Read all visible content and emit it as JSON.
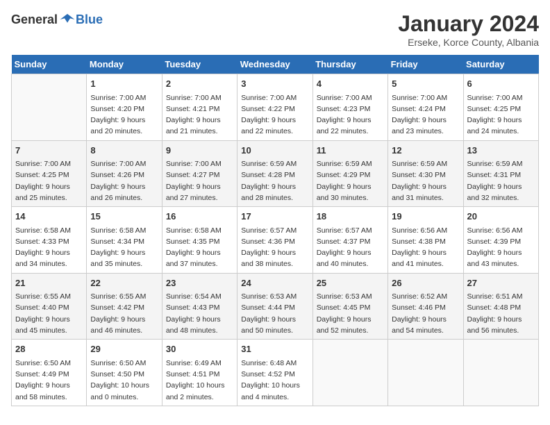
{
  "header": {
    "logo_general": "General",
    "logo_blue": "Blue",
    "month_title": "January 2024",
    "subtitle": "Erseke, Korce County, Albania"
  },
  "days_of_week": [
    "Sunday",
    "Monday",
    "Tuesday",
    "Wednesday",
    "Thursday",
    "Friday",
    "Saturday"
  ],
  "weeks": [
    [
      {
        "day": "",
        "info": ""
      },
      {
        "day": "1",
        "info": "Sunrise: 7:00 AM\nSunset: 4:20 PM\nDaylight: 9 hours\nand 20 minutes."
      },
      {
        "day": "2",
        "info": "Sunrise: 7:00 AM\nSunset: 4:21 PM\nDaylight: 9 hours\nand 21 minutes."
      },
      {
        "day": "3",
        "info": "Sunrise: 7:00 AM\nSunset: 4:22 PM\nDaylight: 9 hours\nand 22 minutes."
      },
      {
        "day": "4",
        "info": "Sunrise: 7:00 AM\nSunset: 4:23 PM\nDaylight: 9 hours\nand 22 minutes."
      },
      {
        "day": "5",
        "info": "Sunrise: 7:00 AM\nSunset: 4:24 PM\nDaylight: 9 hours\nand 23 minutes."
      },
      {
        "day": "6",
        "info": "Sunrise: 7:00 AM\nSunset: 4:25 PM\nDaylight: 9 hours\nand 24 minutes."
      }
    ],
    [
      {
        "day": "7",
        "info": "Sunrise: 7:00 AM\nSunset: 4:25 PM\nDaylight: 9 hours\nand 25 minutes."
      },
      {
        "day": "8",
        "info": "Sunrise: 7:00 AM\nSunset: 4:26 PM\nDaylight: 9 hours\nand 26 minutes."
      },
      {
        "day": "9",
        "info": "Sunrise: 7:00 AM\nSunset: 4:27 PM\nDaylight: 9 hours\nand 27 minutes."
      },
      {
        "day": "10",
        "info": "Sunrise: 6:59 AM\nSunset: 4:28 PM\nDaylight: 9 hours\nand 28 minutes."
      },
      {
        "day": "11",
        "info": "Sunrise: 6:59 AM\nSunset: 4:29 PM\nDaylight: 9 hours\nand 30 minutes."
      },
      {
        "day": "12",
        "info": "Sunrise: 6:59 AM\nSunset: 4:30 PM\nDaylight: 9 hours\nand 31 minutes."
      },
      {
        "day": "13",
        "info": "Sunrise: 6:59 AM\nSunset: 4:31 PM\nDaylight: 9 hours\nand 32 minutes."
      }
    ],
    [
      {
        "day": "14",
        "info": "Sunrise: 6:58 AM\nSunset: 4:33 PM\nDaylight: 9 hours\nand 34 minutes."
      },
      {
        "day": "15",
        "info": "Sunrise: 6:58 AM\nSunset: 4:34 PM\nDaylight: 9 hours\nand 35 minutes."
      },
      {
        "day": "16",
        "info": "Sunrise: 6:58 AM\nSunset: 4:35 PM\nDaylight: 9 hours\nand 37 minutes."
      },
      {
        "day": "17",
        "info": "Sunrise: 6:57 AM\nSunset: 4:36 PM\nDaylight: 9 hours\nand 38 minutes."
      },
      {
        "day": "18",
        "info": "Sunrise: 6:57 AM\nSunset: 4:37 PM\nDaylight: 9 hours\nand 40 minutes."
      },
      {
        "day": "19",
        "info": "Sunrise: 6:56 AM\nSunset: 4:38 PM\nDaylight: 9 hours\nand 41 minutes."
      },
      {
        "day": "20",
        "info": "Sunrise: 6:56 AM\nSunset: 4:39 PM\nDaylight: 9 hours\nand 43 minutes."
      }
    ],
    [
      {
        "day": "21",
        "info": "Sunrise: 6:55 AM\nSunset: 4:40 PM\nDaylight: 9 hours\nand 45 minutes."
      },
      {
        "day": "22",
        "info": "Sunrise: 6:55 AM\nSunset: 4:42 PM\nDaylight: 9 hours\nand 46 minutes."
      },
      {
        "day": "23",
        "info": "Sunrise: 6:54 AM\nSunset: 4:43 PM\nDaylight: 9 hours\nand 48 minutes."
      },
      {
        "day": "24",
        "info": "Sunrise: 6:53 AM\nSunset: 4:44 PM\nDaylight: 9 hours\nand 50 minutes."
      },
      {
        "day": "25",
        "info": "Sunrise: 6:53 AM\nSunset: 4:45 PM\nDaylight: 9 hours\nand 52 minutes."
      },
      {
        "day": "26",
        "info": "Sunrise: 6:52 AM\nSunset: 4:46 PM\nDaylight: 9 hours\nand 54 minutes."
      },
      {
        "day": "27",
        "info": "Sunrise: 6:51 AM\nSunset: 4:48 PM\nDaylight: 9 hours\nand 56 minutes."
      }
    ],
    [
      {
        "day": "28",
        "info": "Sunrise: 6:50 AM\nSunset: 4:49 PM\nDaylight: 9 hours\nand 58 minutes."
      },
      {
        "day": "29",
        "info": "Sunrise: 6:50 AM\nSunset: 4:50 PM\nDaylight: 10 hours\nand 0 minutes."
      },
      {
        "day": "30",
        "info": "Sunrise: 6:49 AM\nSunset: 4:51 PM\nDaylight: 10 hours\nand 2 minutes."
      },
      {
        "day": "31",
        "info": "Sunrise: 6:48 AM\nSunset: 4:52 PM\nDaylight: 10 hours\nand 4 minutes."
      },
      {
        "day": "",
        "info": ""
      },
      {
        "day": "",
        "info": ""
      },
      {
        "day": "",
        "info": ""
      }
    ]
  ]
}
